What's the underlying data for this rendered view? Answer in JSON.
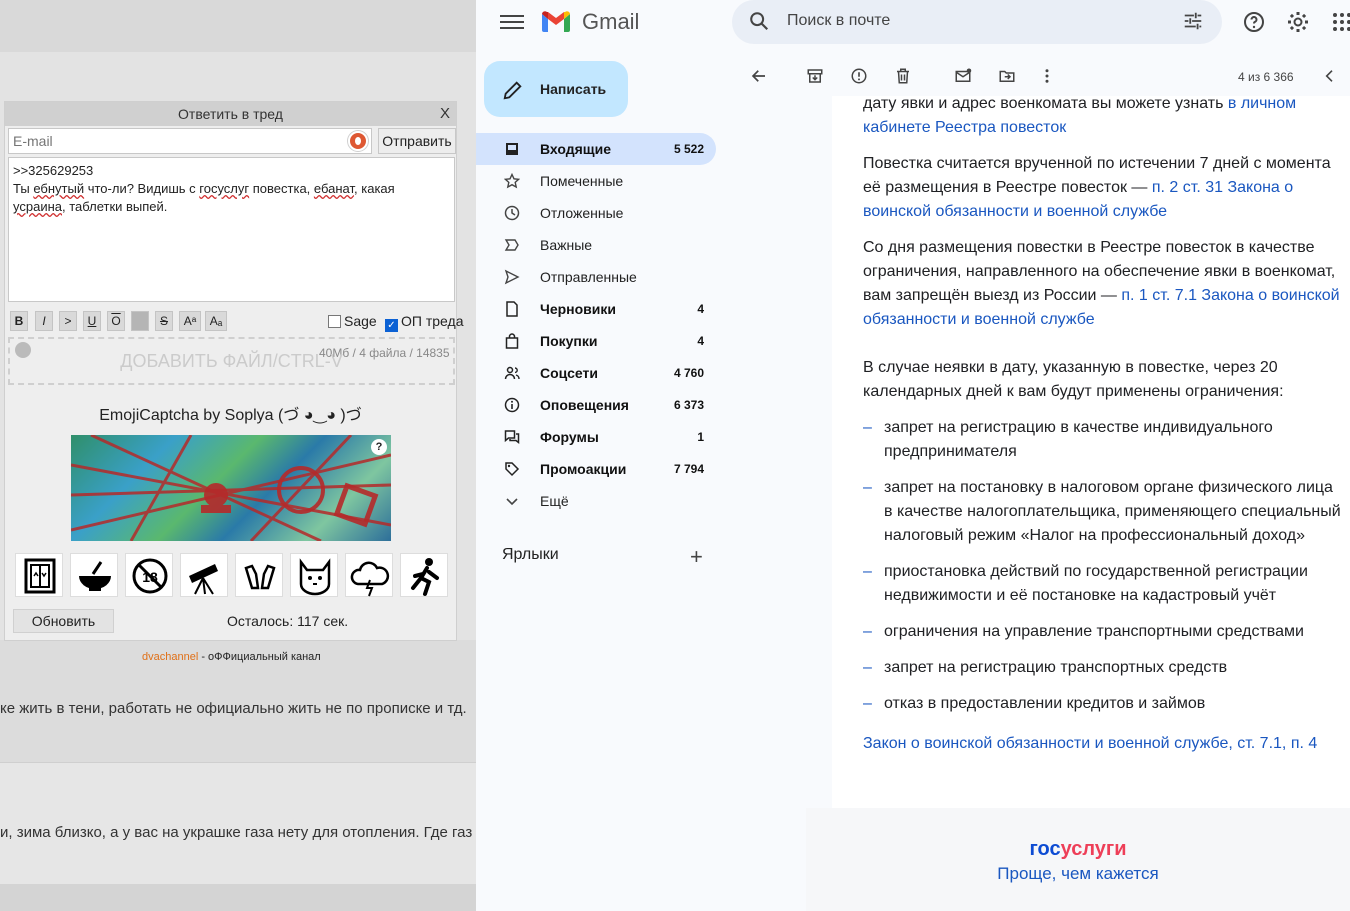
{
  "left": {
    "reply_form": {
      "title": "Ответить в тред",
      "close": "X",
      "email_placeholder": "E-mail",
      "send": "Отправить",
      "message": {
        "line1": ">>325629253",
        "line2_a": "Ты ",
        "line2_b": "ебнутый",
        "line2_c": " что-ли? Видишь с ",
        "line2_d": "госуслуг",
        "line2_e": " повестка, ",
        "line2_f": "ебанат",
        "line2_g": ", какая",
        "line3_a": "усраина",
        "line3_b": ", таблетки выпей."
      },
      "stats": "40Мб / 4 файла / 14835",
      "format_buttons": [
        "B",
        "I",
        ">",
        "U",
        "O",
        "",
        "S",
        "Aᵃ",
        "Aₐ"
      ],
      "sage_label": "Sage",
      "op_label": "ОП треда",
      "drop_label": "ДОБАВИТЬ ФАЙЛ/CTRL-V",
      "captcha_title": "EmojiCaptcha by Soplya (づ ◕‿◕ )づ",
      "captcha_help": "?",
      "emoji_icons": [
        "elevator-icon",
        "bowl-icon",
        "under-18-icon",
        "telescope-icon",
        "hands-icon",
        "cat-icon",
        "storm-cloud-icon",
        "running-man-icon"
      ],
      "refresh": "Обновить",
      "remaining": "Осталось: 117 сек."
    },
    "channel_link": "dvachannel",
    "channel_text": " - оФФициальный канал",
    "post1": "ке жить в тени, работать не официально жить не по прописке и тд.",
    "post2": "и, зима близко, а у вас на украшке газа нету для отопления. Где газ"
  },
  "gmail": {
    "brand": "Gmail",
    "search_placeholder": "Поиск в почте",
    "compose": "Написать",
    "nav": [
      {
        "label": "Входящие",
        "count": "5 522",
        "icon": "inbox-icon",
        "bold": true,
        "active": true
      },
      {
        "label": "Помеченные",
        "count": "",
        "icon": "star-icon",
        "bold": false
      },
      {
        "label": "Отложенные",
        "count": "",
        "icon": "clock-icon",
        "bold": false
      },
      {
        "label": "Важные",
        "count": "",
        "icon": "important-icon",
        "bold": false
      },
      {
        "label": "Отправленные",
        "count": "",
        "icon": "send-icon",
        "bold": false
      },
      {
        "label": "Черновики",
        "count": "4",
        "icon": "draft-icon",
        "bold": true
      },
      {
        "label": "Покупки",
        "count": "4",
        "icon": "shopping-bag-icon",
        "bold": true
      },
      {
        "label": "Соцсети",
        "count": "4 760",
        "icon": "people-icon",
        "bold": true
      },
      {
        "label": "Оповещения",
        "count": "6 373",
        "icon": "info-icon",
        "bold": true
      },
      {
        "label": "Форумы",
        "count": "1",
        "icon": "forum-icon",
        "bold": true
      },
      {
        "label": "Промоакции",
        "count": "7 794",
        "icon": "tag-icon",
        "bold": true
      },
      {
        "label": "Ещё",
        "count": "",
        "icon": "chevron-down-icon",
        "bold": false
      }
    ],
    "labels_heading": "Ярлыки",
    "pagination": "4 из 6 366",
    "email": {
      "p0_text": "дату явки и адрес военкомата вы можете узнать ",
      "p0_link": "в личном кабинете Реестра повесток",
      "p1_text": "Повестка считается врученной по истечении 7 дней с момента её размещения в Реестре повесток — ",
      "p1_link": "п. 2 ст. 31 Закона о воинской обязанности и военной службе",
      "p2_text": "Со дня размещения повестки в Реестре повесток в качестве ограничения, направленного на обеспечение явки в военкомат, вам запрещён выезд из России — ",
      "p2_link": "п. 1 ст. 7.1 Закона о воинской обязанности и военной службе",
      "p3_text": "В случае неявки в дату, указанную в повестке, через 20 календарных дней к вам будут применены ограничения:",
      "list": [
        "запрет на регистрацию в качестве индивидуального предпринимателя",
        "запрет на постановку в налоговом органе физического лица в качестве налогоплательщика, применяющего специальный налоговый режим «Налог на профессиональный доход»",
        "приостановка действий по государственной регистрации недвижимости и её постановке на кадастровый учёт",
        "ограничения на управление транспортными средствами",
        "запрет на регистрацию транспортных средств",
        "отказ в предоставлении кредитов и займов"
      ],
      "law_link": "Закон о воинской обязанности и военной службе, ст. 7.1, п. 4",
      "brand_gos": "гос",
      "brand_uslugi": "услуги",
      "tagline": "Проще, чем кажется"
    }
  },
  "colors": {
    "accent_blue": "#1a57c0",
    "compose_bg": "#c2e7ff",
    "active_nav": "#d3e3fd",
    "gos_red": "#ee3f58",
    "gos_blue": "#0d4cd3"
  }
}
